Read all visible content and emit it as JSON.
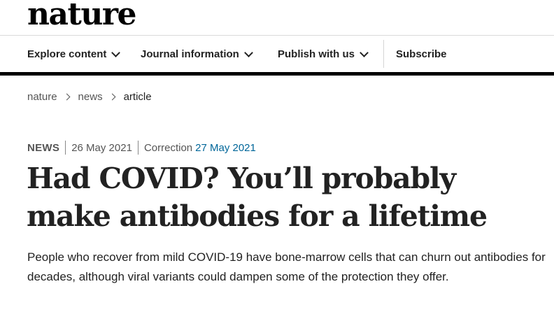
{
  "brand": {
    "logo_text": "nature"
  },
  "nav": {
    "items": [
      {
        "label": "Explore content",
        "has_dropdown": true
      },
      {
        "label": "Journal information",
        "has_dropdown": true
      },
      {
        "label": "Publish with us",
        "has_dropdown": true
      },
      {
        "label": "Subscribe",
        "has_dropdown": false
      }
    ]
  },
  "breadcrumb": [
    "nature",
    "news",
    "article"
  ],
  "article": {
    "type": "NEWS",
    "published_date": "26 May 2021",
    "correction_label": "Correction",
    "correction_date": "27 May 2021",
    "title": "Had COVID? You’ll probably make antibodies for a lifetime",
    "standfirst": "People who recover from mild COVID-19 have bone-marrow cells that can churn out antibodies for decades, although viral variants could dampen some of the protection they offer."
  },
  "colors": {
    "text": "#222222",
    "link_blue": "#006699",
    "nav_border": "#000000"
  }
}
